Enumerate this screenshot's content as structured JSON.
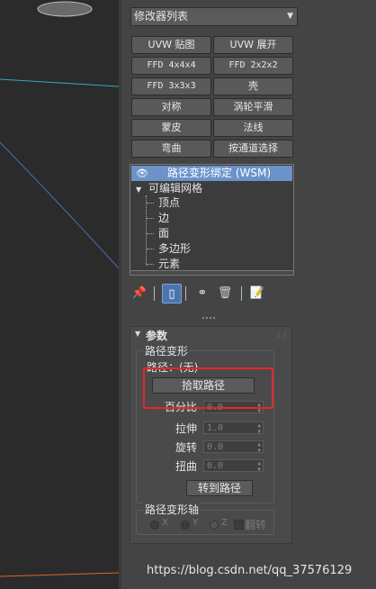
{
  "colors": {
    "panel_bg": "#444444",
    "viewport_bg": "#2b2b2b",
    "selection": "#6b93c9",
    "highlight_box": "#e8262a"
  },
  "modifier_dropdown": {
    "value": "修改器列表"
  },
  "modifier_buttons": [
    {
      "label": "UVW 贴图"
    },
    {
      "label": "UVW 展开"
    },
    {
      "label": "FFD 4x4x4"
    },
    {
      "label": "FFD 2x2x2"
    },
    {
      "label": "FFD 3x3x3"
    },
    {
      "label": "壳"
    },
    {
      "label": "对称"
    },
    {
      "label": "涡轮平滑"
    },
    {
      "label": "蒙皮"
    },
    {
      "label": "法线"
    },
    {
      "label": "弯曲"
    },
    {
      "label": "按通道选择"
    }
  ],
  "stack": {
    "selected": "路径变形绑定 (WSM)",
    "base": "可编辑网格",
    "subobjects": [
      "顶点",
      "边",
      "面",
      "多边形",
      "元素"
    ]
  },
  "toolbar_icons": [
    "pin-stack-icon",
    "show-end-result-icon",
    "make-unique-icon",
    "remove-modifier-icon",
    "configure-sets-icon"
  ],
  "params": {
    "title": "参数",
    "group_path": "路径变形",
    "path_label": "路径：(无)",
    "pick_path": "拾取路径",
    "percent_label": "百分比",
    "percent_value": "0.0",
    "stretch_label": "拉伸",
    "stretch_value": "1.0",
    "rotation_label": "旋转",
    "rotation_value": "0.0",
    "twist_label": "扭曲",
    "twist_value": "0.0",
    "move_to_path": "转到路径",
    "axis_group": "路径变形轴",
    "axis_x": "X",
    "axis_y": "Y",
    "axis_z": "Z",
    "flip": "翻转"
  },
  "watermark": "https://blog.csdn.net/qq_37576129"
}
